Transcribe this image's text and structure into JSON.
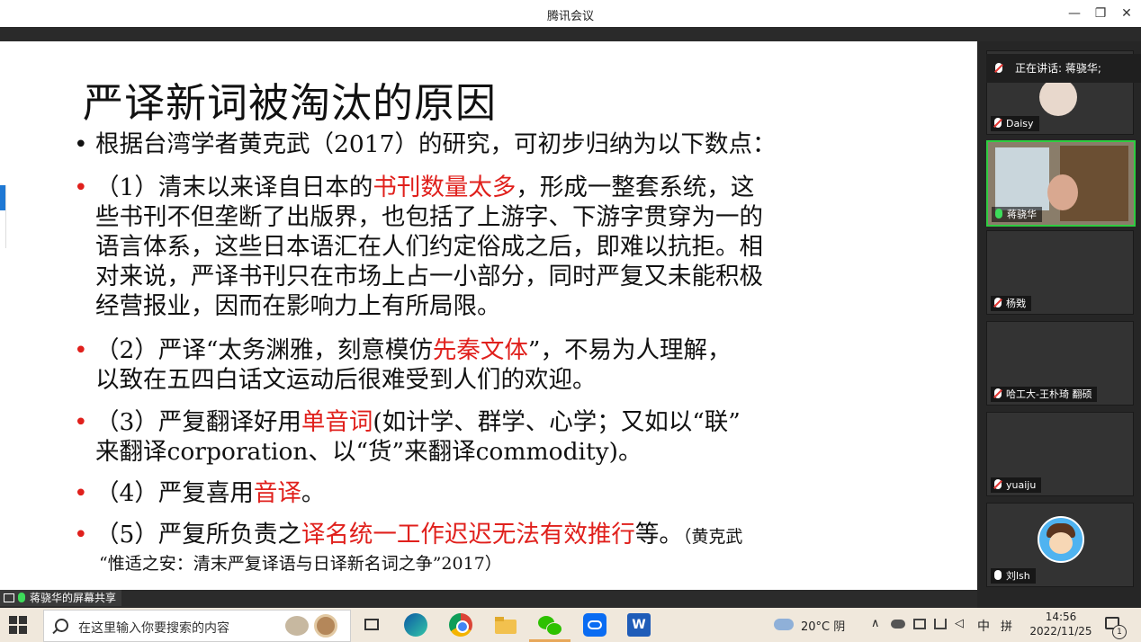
{
  "window": {
    "title": "腾讯会议"
  },
  "slide": {
    "title": "严译新词被淘汰的原因",
    "intro": "根据台湾学者黄克武（2017）的研究，可初步归纳为以下数点：",
    "bullet": "•",
    "p1": {
      "l1a": "（1）清末以来译自日本的",
      "l1red": "书刊数量太多",
      "l1b": "，形成一整套系统，这",
      "l2": "些书刊不但垄断了出版界，也包括了上游字、下游字贯穿为一的",
      "l3": "语言体系，这些日本语汇在人们约定俗成之后，即难以抗拒。相",
      "l4": "对来说，严译书刊只在市场上占一小部分，同时严复又未能积极",
      "l5": "经营报业，因而在影响力上有所局限。"
    },
    "p2": {
      "l1a": "（2）严译“太务渊雅，刻意模仿",
      "l1red": "先秦文体",
      "l1b": "”，不易为人理解，",
      "l2": "以致在五四白话文运动后很难受到人们的欢迎。"
    },
    "p3": {
      "l1a": "（3）严复翻译好用",
      "l1red": "单音词",
      "l1b": "(如计学、群学、心学；又如以“联”",
      "l2": "来翻译corporation、以“货”来翻译commodity)。"
    },
    "p4": {
      "l1a": "（4）严复喜用",
      "l1red": "音译",
      "l1b": "。"
    },
    "p5": {
      "l1a": "（5）严复所负责之",
      "l1red": "译名统一工作迟迟无法有效推行",
      "l1b": "等。",
      "cite1": "（黄克武",
      "cite2": "“惟适之安：清末严复译语与日译新名词之争”2017）"
    }
  },
  "share_label": "蒋骁华的屏幕共享",
  "speaking": "正在讲话: 蒋骁华;",
  "participants": [
    {
      "name": "Daisy"
    },
    {
      "name": "蒋骁华"
    },
    {
      "name": "杨戣"
    },
    {
      "name": "哈工大-王朴琦 翻硕"
    },
    {
      "name": "yuaiju"
    },
    {
      "name": "刘lsh"
    }
  ],
  "taskbar": {
    "search_placeholder": "在这里输入你要搜索的内容",
    "weather": "20°C 阴",
    "ime": "中",
    "ime2": "拼",
    "time": "14:56",
    "date": "2022/11/25",
    "notif_count": "1"
  },
  "colors": {
    "accent_red": "#e0201c",
    "active_border": "#2ecc40"
  }
}
